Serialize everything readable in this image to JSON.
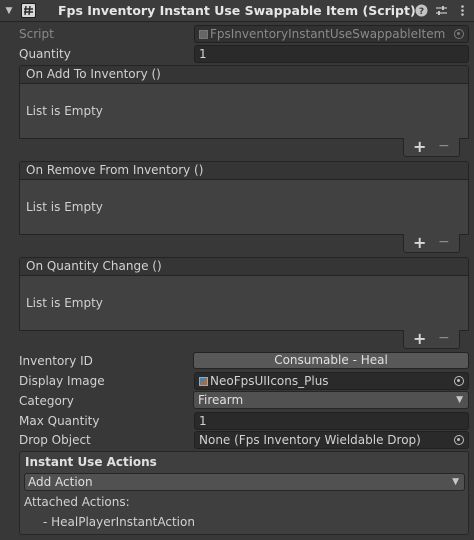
{
  "header": {
    "title": "Fps Inventory Instant Use Swappable Item (Script)",
    "icons": [
      "foldout-arrow-icon",
      "script-checkbox-icon",
      "help-icon",
      "settings-sliders-icon",
      "context-menu-icon"
    ]
  },
  "script": {
    "label": "Script",
    "value": "FpsInventoryInstantUseSwappableItem"
  },
  "quantity": {
    "label": "Quantity",
    "value": "1"
  },
  "events": [
    {
      "title": "On Add To Inventory ()",
      "body": "List is Empty"
    },
    {
      "title": "On Remove From Inventory ()",
      "body": "List is Empty"
    },
    {
      "title": "On Quantity Change ()",
      "body": "List is Empty"
    }
  ],
  "list_buttons": {
    "add": "+",
    "remove": "−"
  },
  "inventory_id": {
    "label": "Inventory ID",
    "value": "Consumable - Heal"
  },
  "display_image": {
    "label": "Display Image",
    "value": "NeoFpsUIIcons_Plus"
  },
  "category": {
    "label": "Category",
    "value": "Firearm"
  },
  "max_quantity": {
    "label": "Max Quantity",
    "value": "1"
  },
  "drop_object": {
    "label": "Drop Object",
    "value": "None (Fps Inventory Wieldable Drop)"
  },
  "instant_use": {
    "title": "Instant Use Actions",
    "add_action": "Add Action",
    "attached_label": "Attached Actions:",
    "attached": [
      "- HealPlayerInstantAction"
    ]
  },
  "colors": {
    "background": "#383838",
    "field": "#2a2a2a",
    "button": "#585858",
    "dropdown": "#515151"
  }
}
